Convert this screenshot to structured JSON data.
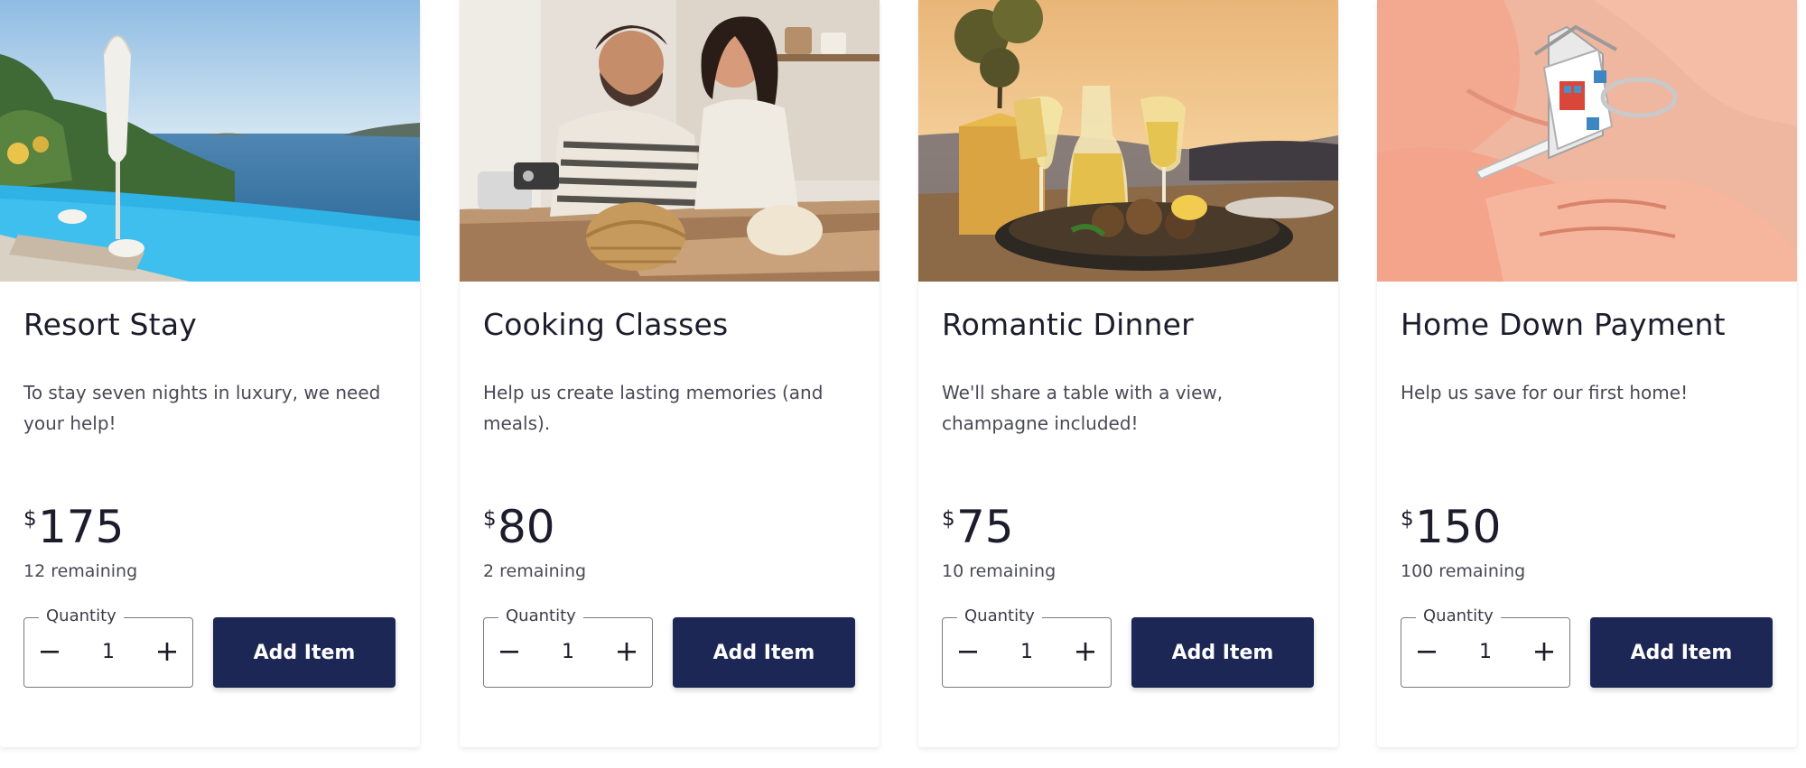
{
  "items": [
    {
      "title": "Resort Stay",
      "description": "To stay seven nights in luxury, we need your help!",
      "currency": "$",
      "price": "175",
      "remaining": "12 remaining",
      "quantity_label": "Quantity",
      "quantity": "1",
      "add_label": "Add Item",
      "image_icon": "resort-pool-photo"
    },
    {
      "title": "Cooking Classes",
      "description": "Help us create lasting memories (and meals).",
      "currency": "$",
      "price": "80",
      "remaining": "2 remaining",
      "quantity_label": "Quantity",
      "quantity": "1",
      "add_label": "Add Item",
      "image_icon": "cooking-couple-photo"
    },
    {
      "title": "Romantic Dinner",
      "description": "We'll share a table with a view, champagne included!",
      "currency": "$",
      "price": "75",
      "remaining": "10 remaining",
      "quantity_label": "Quantity",
      "quantity": "1",
      "add_label": "Add Item",
      "image_icon": "sunset-dinner-photo"
    },
    {
      "title": "Home Down Payment",
      "description": "Help us save for our first home!",
      "currency": "$",
      "price": "150",
      "remaining": "100 remaining",
      "quantity_label": "Quantity",
      "quantity": "1",
      "add_label": "Add Item",
      "image_icon": "house-key-photo"
    }
  ],
  "colors": {
    "button_bg": "#1c2755",
    "button_text": "#ffffff",
    "title": "#1c1c2c",
    "body_text": "#4a4a55",
    "border": "#7a7a86"
  }
}
